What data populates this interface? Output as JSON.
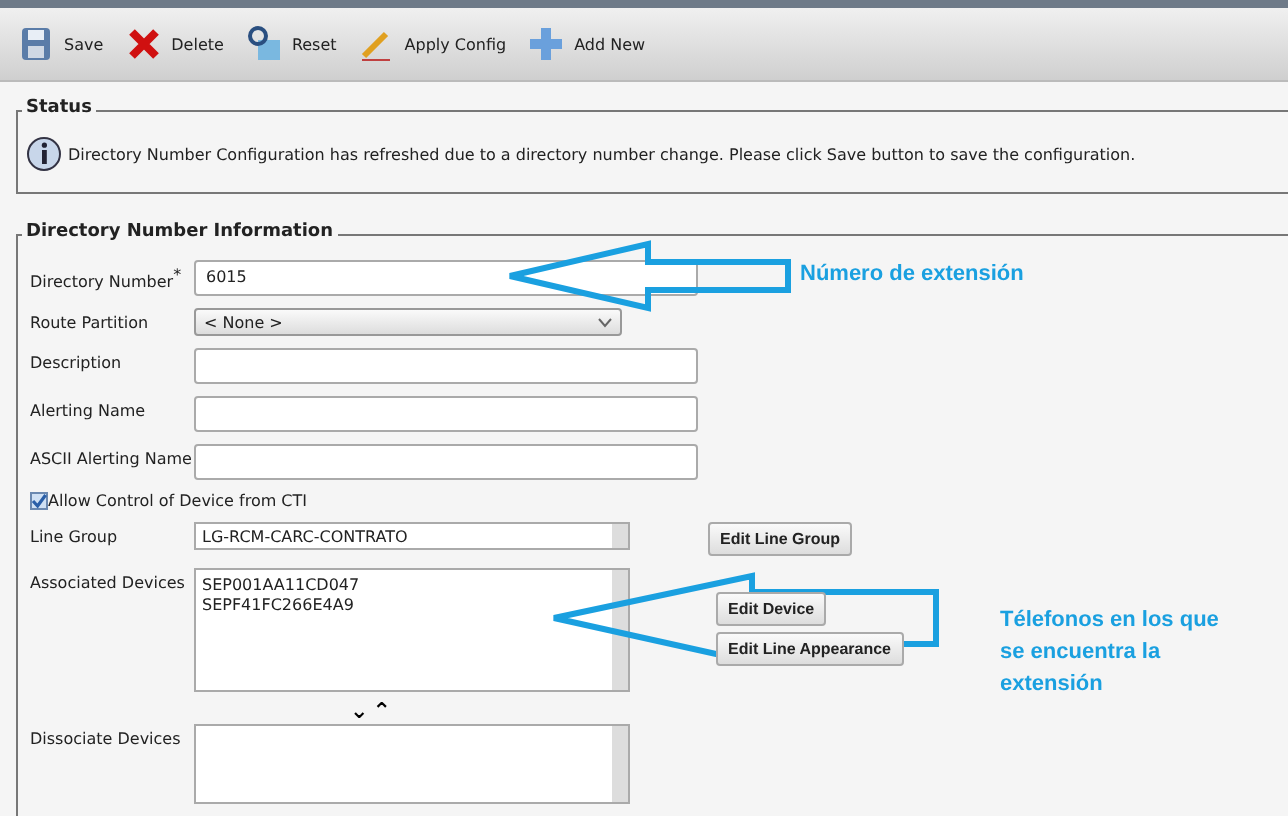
{
  "toolbar": [
    {
      "kind": "save",
      "label": "Save"
    },
    {
      "kind": "delete",
      "label": "Delete"
    },
    {
      "kind": "reset",
      "label": "Reset"
    },
    {
      "kind": "apply",
      "label": "Apply Config"
    },
    {
      "kind": "add",
      "label": "Add New"
    }
  ],
  "status": {
    "title": "Status",
    "message": "Directory Number Configuration has refreshed due to a directory number change. Please click Save button to save the configuration."
  },
  "dn_info": {
    "title": "Directory Number Information",
    "directory_number": {
      "label": "Directory Number",
      "required_mark": "*",
      "value": "6015"
    },
    "route_partition": {
      "label": "Route Partition",
      "value": "< None >"
    },
    "description": {
      "label": "Description"
    },
    "alerting_name": {
      "label": "Alerting Name"
    },
    "ascii_alerting_name": {
      "label": "ASCII Alerting Name"
    },
    "allow_cti": {
      "label": "Allow Control of Device from CTI",
      "checked": true
    },
    "line_group": {
      "label": "Line Group",
      "value": "LG-RCM-CARC-CONTRATO",
      "button": "Edit Line Group"
    },
    "associated_devices": {
      "label": "Associated Devices",
      "items": [
        "SEP001AA11CD047",
        "SEPF41FC266E4A9"
      ],
      "buttons": [
        "Edit Device",
        "Edit Line Appearance"
      ]
    },
    "move_buttons": [
      "⌄",
      "⌃"
    ],
    "dissociate_devices": {
      "label": "Dissociate Devices"
    }
  },
  "annotations": [
    {
      "text": "Número de extensión"
    },
    {
      "text": "Télefonos en los que se encuentra la extensión"
    }
  ]
}
